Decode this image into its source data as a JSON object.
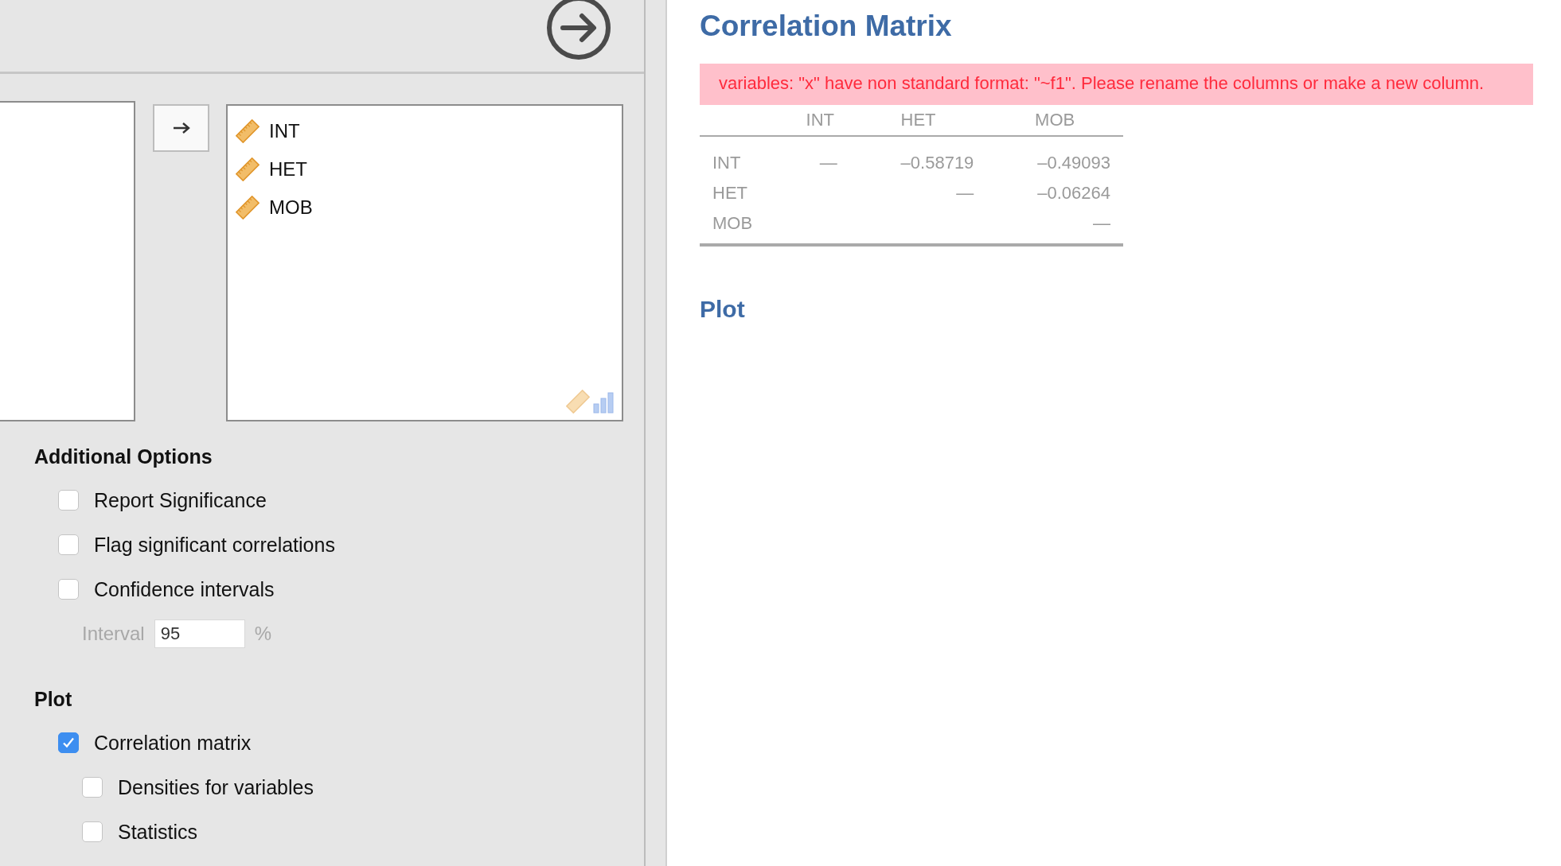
{
  "variables": {
    "selected": [
      {
        "name": "INT"
      },
      {
        "name": "HET"
      },
      {
        "name": "MOB"
      }
    ]
  },
  "additional_options": {
    "title": "Additional Options",
    "options": [
      {
        "label": "Report Significance",
        "checked": false
      },
      {
        "label": "Flag significant correlations",
        "checked": false
      },
      {
        "label": "Confidence intervals",
        "checked": false
      }
    ],
    "interval": {
      "label": "Interval",
      "value": "95",
      "unit": "%",
      "disabled": true
    }
  },
  "plot": {
    "title": "Plot",
    "options": [
      {
        "label": "Correlation matrix",
        "checked": true,
        "children": [
          {
            "label": "Densities for variables",
            "checked": false
          },
          {
            "label": "Statistics",
            "checked": false
          }
        ]
      }
    ]
  },
  "results": {
    "title": "Correlation Matrix",
    "error": "variables: \"x\" have non standard format: \"~f1\". Please rename the columns or make a new column.",
    "table": {
      "columns": [
        "INT",
        "HET",
        "MOB"
      ],
      "rows": [
        {
          "label": "INT",
          "cells": [
            "—",
            "–0.58719",
            "–0.49093"
          ]
        },
        {
          "label": "HET",
          "cells": [
            null,
            "—",
            "–0.06264"
          ]
        },
        {
          "label": "MOB",
          "cells": [
            null,
            null,
            "—"
          ]
        }
      ]
    },
    "plot_title": "Plot"
  }
}
